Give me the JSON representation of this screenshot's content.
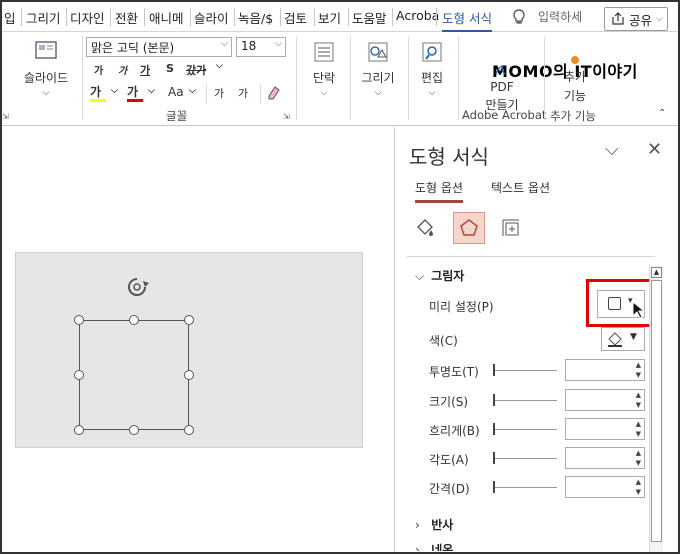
{
  "tabs": [
    "입",
    "그리기",
    "디자인",
    "전환",
    "애니메",
    "슬라이",
    "녹음/$",
    "검토",
    "보기",
    "도움말",
    "Acroba",
    "도형 서식"
  ],
  "search_placeholder": "입력하세",
  "share_label": "공유",
  "brand_text": "MOMO의 IT이야기",
  "ribbon": {
    "slide_label": "슬라이드",
    "font_name": "맑은 고딕 (본문)",
    "font_size": "18",
    "font_group_label": "글꼴",
    "paragraph_label": "단락",
    "draw_label": "그리기",
    "edit_label": "편집",
    "pdf_label1": "PDF",
    "pdf_label2": "만들기",
    "acrobat_group_label": "Adobe Acrobat",
    "addon_label1": "추가",
    "addon_label2": "기능",
    "addon_group_label": "추가 기능",
    "fmt_row1": [
      "가",
      "가",
      "가",
      "S",
      "갔가"
    ],
    "fmt_row2": [
      "가",
      "가",
      "Aa",
      "가",
      "가"
    ]
  },
  "pane": {
    "title": "도형 서식",
    "tab_shape": "도형 옵션",
    "tab_text": "텍스트 옵션",
    "section_shadow": "그림자",
    "preset_label": "미리 설정(P)",
    "color_label": "색(C)",
    "transparency_label": "투명도(T)",
    "size_label": "크기(S)",
    "blur_label": "흐리게(B)",
    "angle_label": "각도(A)",
    "distance_label": "간격(D)",
    "section_reflection": "반사",
    "section_glow": "네온"
  }
}
